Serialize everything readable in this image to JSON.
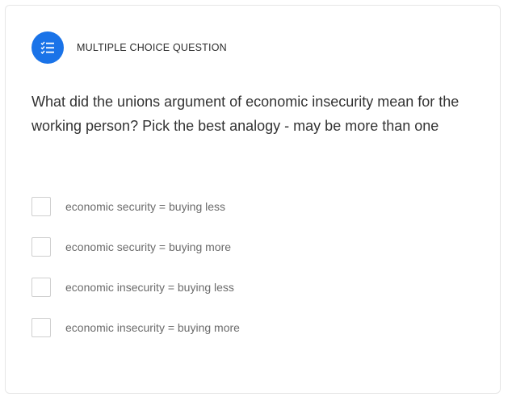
{
  "question": {
    "type_label": "MULTIPLE CHOICE QUESTION",
    "type_icon": "checklist-icon",
    "text": "What did the unions argument of economic insecurity mean for the working person? Pick the best analogy - may be more than one",
    "options": [
      {
        "label": "economic security = buying less",
        "checked": false
      },
      {
        "label": "economic security = buying more",
        "checked": false
      },
      {
        "label": "economic insecurity = buying less",
        "checked": false
      },
      {
        "label": "economic insecurity = buying more",
        "checked": false
      }
    ]
  },
  "colors": {
    "accent": "#1a73e8",
    "question_text": "#333333",
    "option_text": "#6b6b6b",
    "checkbox_border": "#cfcfcf"
  }
}
